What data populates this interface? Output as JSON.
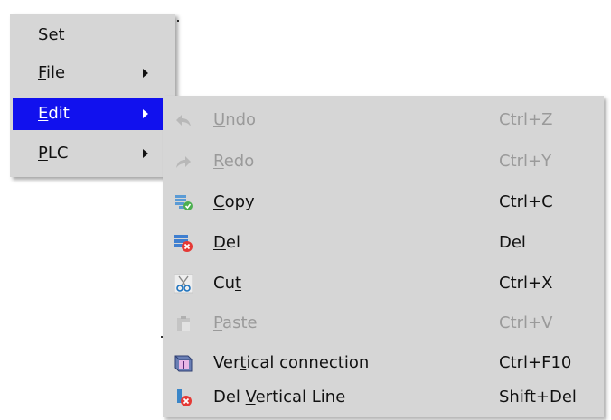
{
  "main_menu": {
    "items": [
      {
        "prefix": "",
        "key": "S",
        "rest": "et",
        "has_submenu": false,
        "active": false
      },
      {
        "prefix": "",
        "key": "F",
        "rest": "ile",
        "has_submenu": true,
        "active": false
      },
      {
        "prefix": "",
        "key": "E",
        "rest": "dit",
        "has_submenu": true,
        "active": true
      },
      {
        "prefix": "",
        "key": "P",
        "rest": "LC",
        "has_submenu": true,
        "active": false
      }
    ]
  },
  "edit_submenu": {
    "items": [
      {
        "prefix": "",
        "key": "U",
        "rest": "ndo",
        "shortcut": "Ctrl+Z",
        "icon": "undo-icon",
        "enabled": false
      },
      {
        "prefix": "",
        "key": "R",
        "rest": "edo",
        "shortcut": "Ctrl+Y",
        "icon": "redo-icon",
        "enabled": false
      },
      {
        "prefix": "",
        "key": "C",
        "rest": "opy",
        "shortcut": "Ctrl+C",
        "icon": "copy-icon",
        "enabled": true
      },
      {
        "prefix": "",
        "key": "D",
        "rest": "el",
        "shortcut": "Del",
        "icon": "delete-icon",
        "enabled": true
      },
      {
        "prefix": "Cu",
        "key": "t",
        "rest": "",
        "shortcut": "Ctrl+X",
        "icon": "cut-icon",
        "enabled": true
      },
      {
        "prefix": "",
        "key": "P",
        "rest": "aste",
        "shortcut": "Ctrl+V",
        "icon": "paste-icon",
        "enabled": false
      },
      {
        "prefix": "Ver",
        "key": "t",
        "rest": "ical connection",
        "shortcut": "Ctrl+F10",
        "icon": "vertical-connection-icon",
        "enabled": true
      },
      {
        "prefix": "Del ",
        "key": "V",
        "rest": "ertical Line",
        "shortcut": "Shift+Del",
        "icon": "delete-vertical-line-icon",
        "enabled": true
      }
    ]
  },
  "colors": {
    "menu_background": "#d6d6d6",
    "highlight": "#1111ee",
    "disabled_text": "#9a9a9a"
  }
}
